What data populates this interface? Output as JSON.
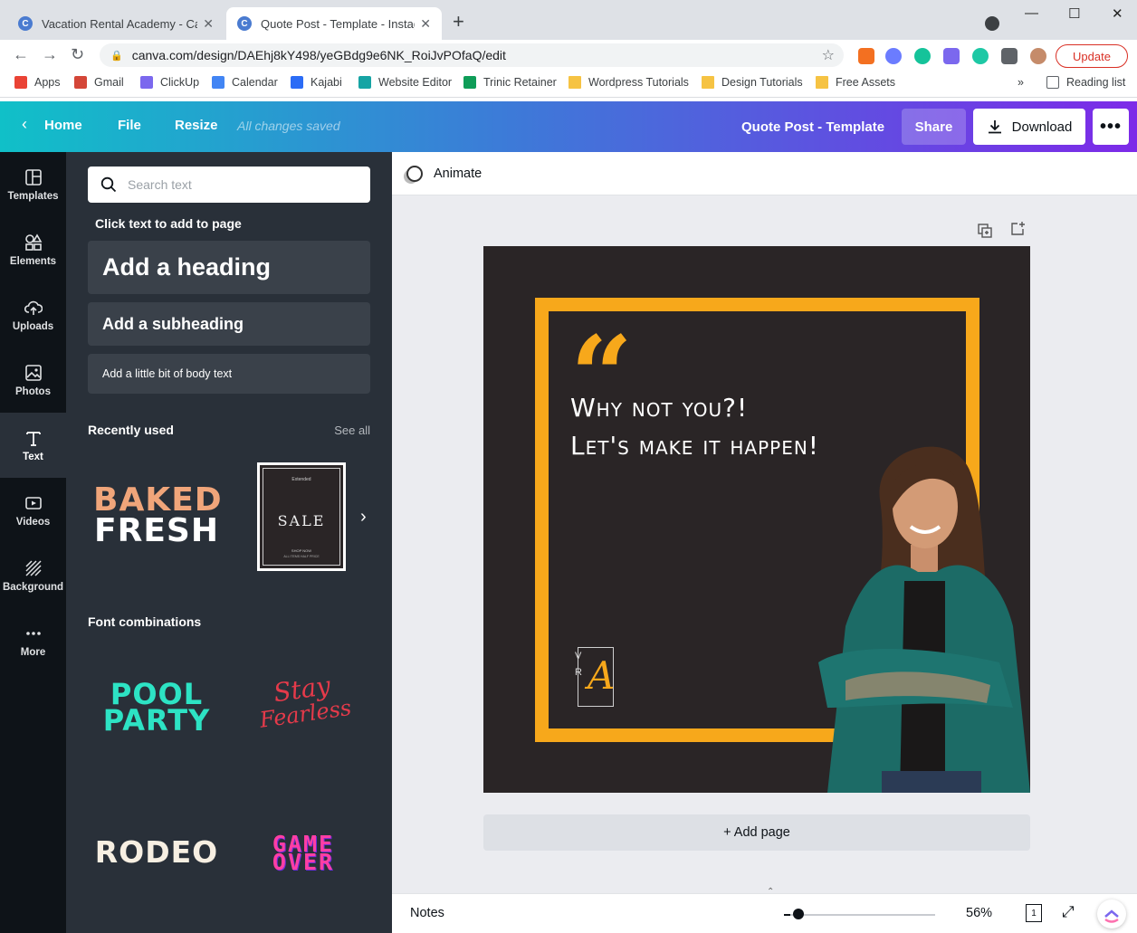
{
  "browser": {
    "tabs": [
      {
        "title": "Vacation Rental Academy - Canva",
        "favicon": "C"
      },
      {
        "title": "Quote Post - Template - Instagram",
        "favicon": "C"
      }
    ],
    "url": "canva.com/design/DAEhj8kY498/yeGBdg9e6NK_RoiJvPOfaQ/edit",
    "update_label": "Update",
    "bookmarks": [
      "Apps",
      "Gmail",
      "ClickUp",
      "Calendar",
      "Kajabi",
      "Website Editor",
      "Trinic Retainer",
      "Wordpress Tutorials",
      "Design Tutorials",
      "Free Assets"
    ],
    "reading_list": "Reading list",
    "more_bookmarks": "»"
  },
  "header": {
    "home": "Home",
    "file": "File",
    "resize": "Resize",
    "saved": "All changes saved",
    "title": "Quote Post - Template",
    "share": "Share",
    "download": "Download",
    "more": "•••"
  },
  "rail": {
    "items": [
      "Templates",
      "Elements",
      "Uploads",
      "Photos",
      "Text",
      "Videos",
      "Background",
      "More"
    ],
    "active": "Text"
  },
  "panel": {
    "search_placeholder": "Search text",
    "click_text": "Click text to add to page",
    "heading": "Add a heading",
    "subheading": "Add a subheading",
    "body": "Add a little bit of body text",
    "recently_used": "Recently used",
    "see_all": "See all",
    "recent_items": {
      "baked_line1": "BAKED",
      "baked_line2": "FRESH",
      "sale_top": "Extended",
      "sale": "SALE",
      "sale_bottom1": "SHOP NOW",
      "sale_bottom2": "ALL ITEMS HALF PRICE"
    },
    "font_combinations": "Font combinations",
    "combos": {
      "pool_line1": "POOL",
      "pool_line2": "PARTY",
      "stay_line1": "Stay",
      "stay_line2": "Fearless",
      "rodeo": "RODEO",
      "game_line1": "GAME",
      "game_line2": "OVER"
    }
  },
  "editor": {
    "animate": "Animate",
    "quote_line1": "Why not you?!",
    "quote_line2": "Let's make it happen!",
    "logo_v": "V",
    "logo_r": "R",
    "logo_a": "A",
    "add_page": "+ Add page",
    "notes": "Notes",
    "zoom": "56%",
    "page_count": "1"
  },
  "colors": {
    "accent_yellow": "#f7a81b",
    "canvas_bg": "#2a2526",
    "panel_bg": "#293039",
    "rail_bg": "#0e1318",
    "header_start": "#10c0c8",
    "header_end": "#7d2ae8"
  }
}
